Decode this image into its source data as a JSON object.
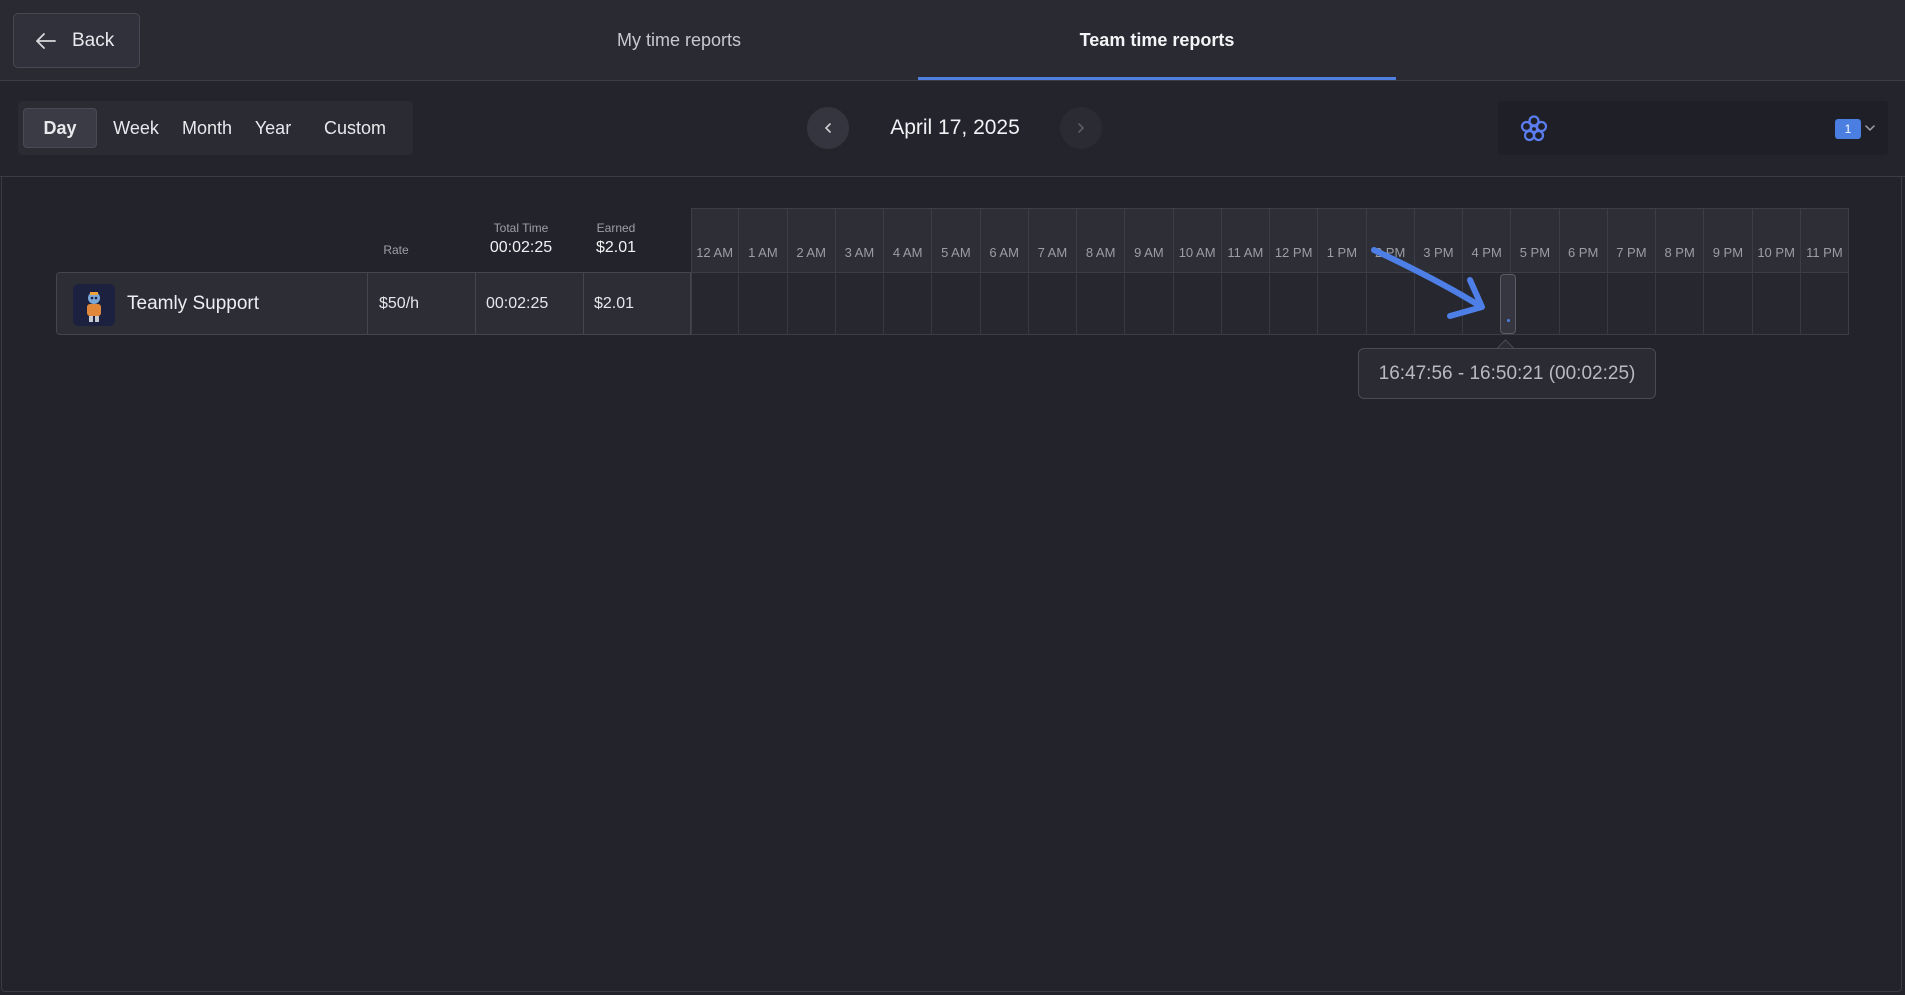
{
  "header": {
    "back_label": "Back",
    "tabs": [
      {
        "label": "My time reports",
        "active": false
      },
      {
        "label": "Team time reports",
        "active": true
      }
    ]
  },
  "toolbar": {
    "ranges": [
      "Day",
      "Week",
      "Month",
      "Year",
      "Custom"
    ],
    "active_range": "Day",
    "date": "April 17, 2025",
    "team_count_badge": "1"
  },
  "table": {
    "columns": {
      "rate_label": "Rate",
      "total_time_label": "Total Time",
      "total_time_value": "00:02:25",
      "earned_label": "Earned",
      "earned_value": "$2.01"
    },
    "rows": [
      {
        "name": "Teamly Support",
        "rate": "$50/h",
        "total_time": "00:02:25",
        "earned": "$2.01"
      }
    ]
  },
  "timeline": {
    "hours": [
      "12 AM",
      "1 AM",
      "2 AM",
      "3 AM",
      "4 AM",
      "5 AM",
      "6 AM",
      "7 AM",
      "8 AM",
      "9 AM",
      "10 AM",
      "11 AM",
      "12 PM",
      "1 PM",
      "2 PM",
      "3 PM",
      "4 PM",
      "5 PM",
      "6 PM",
      "7 PM",
      "8 PM",
      "9 PM",
      "10 PM",
      "11 PM"
    ],
    "entry_tooltip": "16:47:56 - 16:50:21 (00:02:25)"
  },
  "colors": {
    "accent": "#4f7fe0",
    "background": "#22232b"
  },
  "icons": {
    "back": "arrow-left-icon",
    "prev": "chevron-left-icon",
    "next": "chevron-right-icon",
    "team_logo": "flower-logo-icon",
    "dropdown": "chevron-down-icon"
  }
}
